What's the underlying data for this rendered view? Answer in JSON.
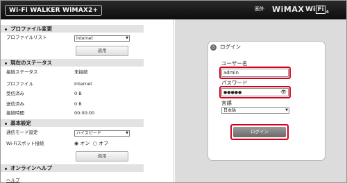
{
  "header": {
    "logo_text": "Wi-Fi WALKER WiMAX2+",
    "status_out_of_service": "圏外",
    "wimax_label": "WiMAX",
    "wifi_label_main": "Wi",
    "wifi_label_box": "Fi",
    "wifi_sub": "4"
  },
  "profile_section": {
    "title": "プロファイル変更",
    "list_label": "プロファイルリスト",
    "selected_profile": "Internet",
    "apply_label": "適用"
  },
  "status_section": {
    "title": "現在のステータス",
    "rows": [
      {
        "label": "接続ステータス",
        "value": "未接続"
      },
      {
        "label": "プロファイル",
        "value": "Internet"
      },
      {
        "label": "受信済み",
        "value": "0 B"
      },
      {
        "label": "送信済み",
        "value": "0 B"
      },
      {
        "label": "接続時間",
        "value": "00:00:00"
      }
    ]
  },
  "basic_section": {
    "title": "基本設定",
    "comm_mode_label": "通信モード設定",
    "comm_mode_value": "ハイスピード",
    "spot_label": "Wi-Fiスポット接続",
    "radio_on": "オン",
    "radio_off": "オフ",
    "apply_label": "適用"
  },
  "help_section": {
    "title": "オンラインヘルプ",
    "help_link": "ヘルプ"
  },
  "login": {
    "title": "ログイン",
    "username_label": "ユーザー名",
    "username_value": "admin",
    "password_label": "パスワード",
    "password_value": "●●●●●",
    "language_label": "言語",
    "language_value": "日本語",
    "login_button": "ログイン"
  },
  "colors": {
    "highlight": "#d6001c",
    "header_bg": "#111111",
    "panel_bg": "#dcdcdc"
  },
  "icons": {
    "login_icon": "login-circle-icon",
    "eye_icon": "eye-icon"
  }
}
